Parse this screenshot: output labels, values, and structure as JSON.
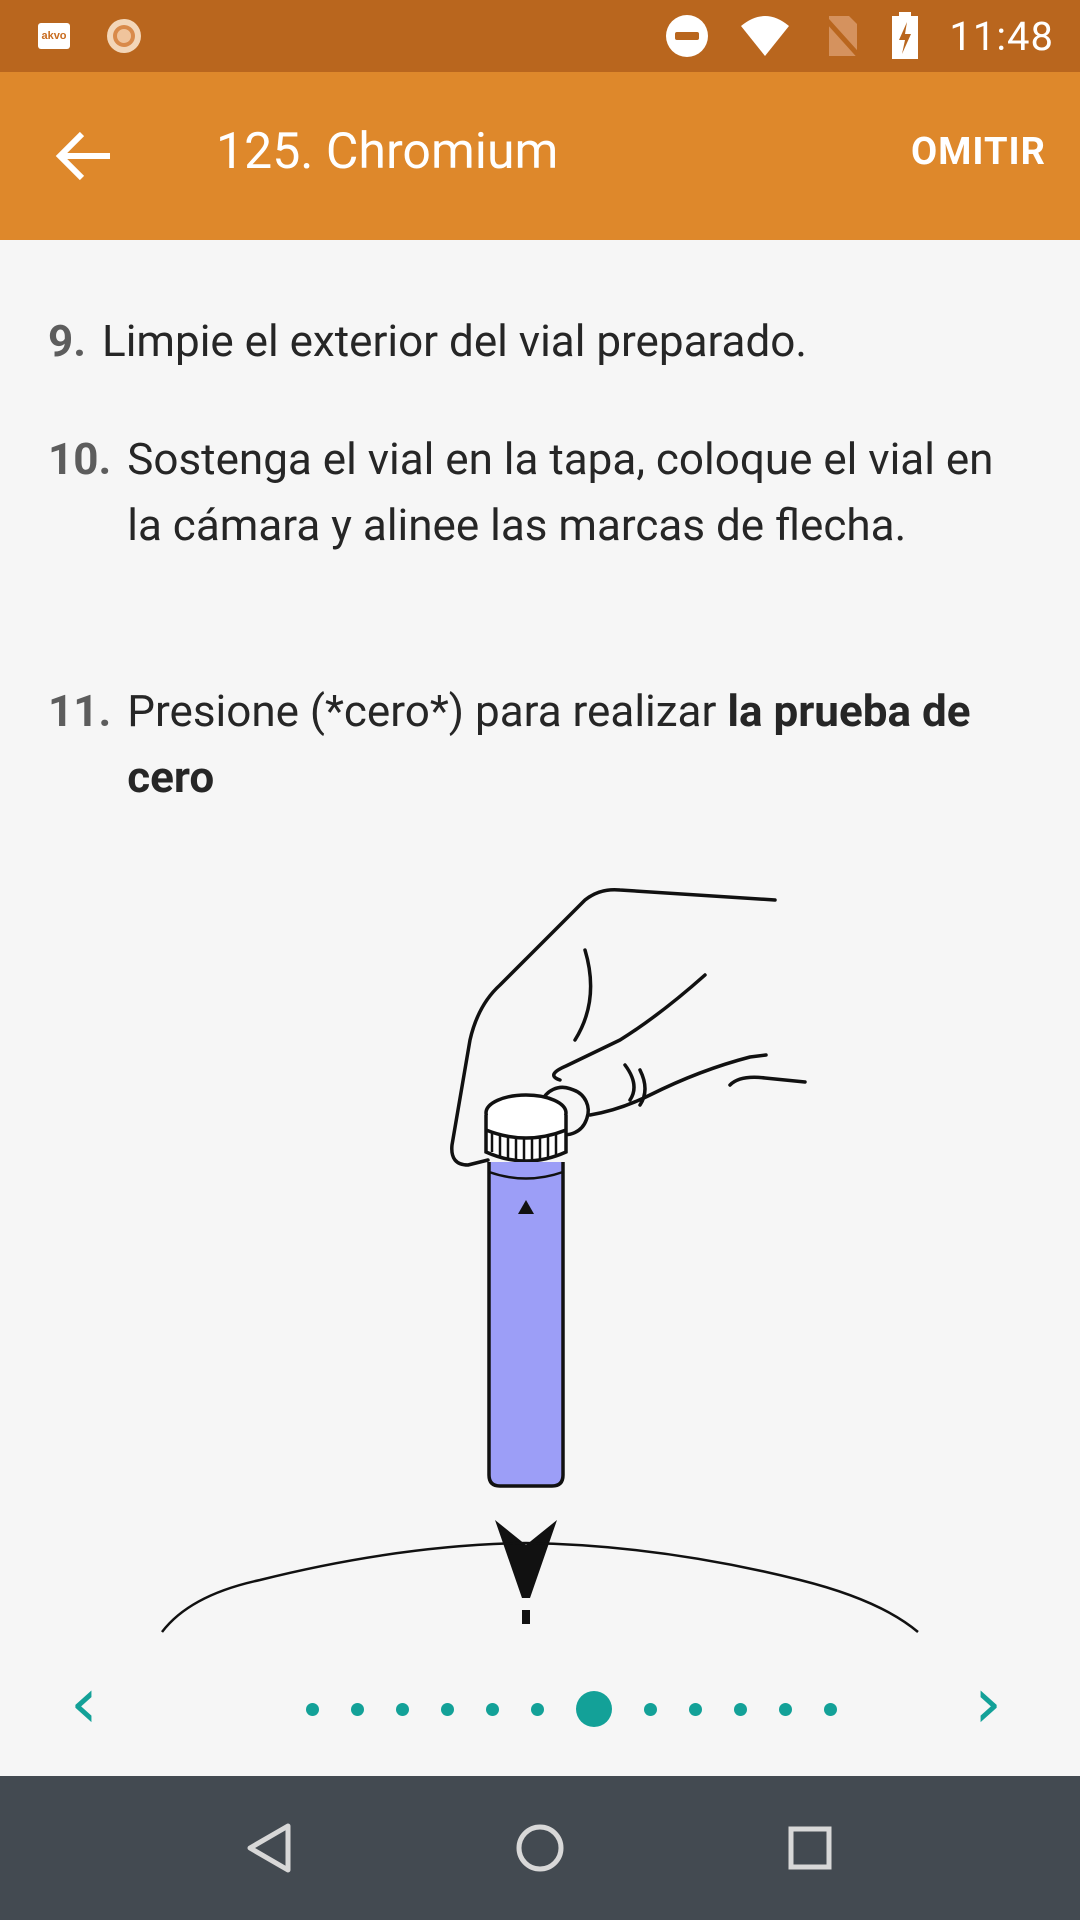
{
  "status_bar": {
    "app_icon_label": "akvo",
    "time": "11:48",
    "icons": [
      "akvo-icon",
      "sun-icon",
      "do-not-disturb-icon",
      "wifi-icon",
      "no-sim-icon",
      "battery-charging-icon"
    ]
  },
  "app_bar": {
    "title": "125. Chromium",
    "skip_label": "OMITIR",
    "back_icon": "arrow-back-icon",
    "color": "#de882b"
  },
  "steps": [
    {
      "number": "9.",
      "text": "Limpie el exterior del vial preparado."
    },
    {
      "number": "10.",
      "text": "Sostenga el vial en la tapa, coloque el vial en la cámara y alinee las marcas de flecha."
    },
    {
      "number": "11.",
      "text_before": "Presione (*cero*) para realizar ",
      "text_bold": "la prueba de cero"
    }
  ],
  "pager": {
    "accent_color": "#13a198",
    "page_count": 12,
    "current_page": 7,
    "prev_icon": "chevron-left-icon",
    "next_icon": "chevron-right-icon",
    "prev_glyph": "‹",
    "next_glyph": "›"
  },
  "nav_bar": {
    "icons": [
      "nav-back-icon",
      "nav-home-icon",
      "nav-recents-icon"
    ]
  }
}
